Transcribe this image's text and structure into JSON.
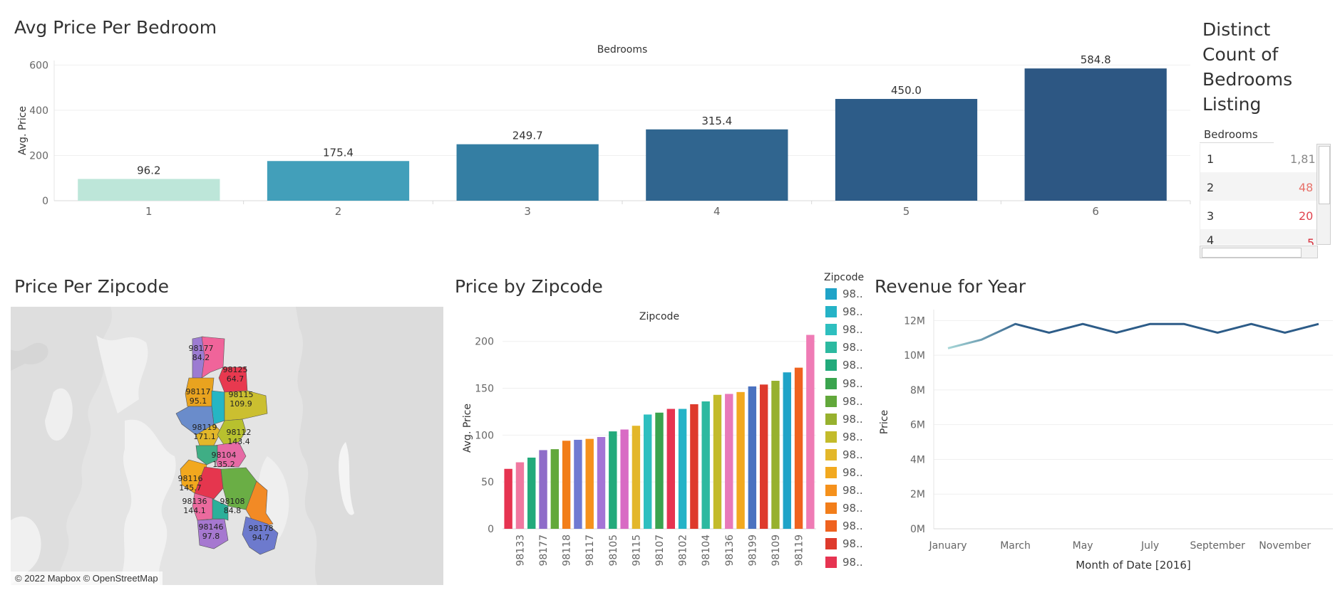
{
  "panels": {
    "avg_price_per_bedroom": {
      "title": "Avg Price Per Bedroom"
    },
    "distinct_count": {
      "title_lines": [
        "Distinct",
        "Count of",
        "Bedrooms",
        "Listing"
      ]
    },
    "price_per_zipcode": {
      "title": "Price Per Zipcode",
      "attribution": "© 2022 Mapbox © OpenStreetMap"
    },
    "price_by_zipcode": {
      "title": "Price by Zipcode"
    },
    "revenue_for_year": {
      "title": "Revenue for Year"
    }
  },
  "count_table": {
    "header": "Bedrooms",
    "rows": [
      {
        "bedrooms": "1",
        "count": "1,81",
        "color": "#888888"
      },
      {
        "bedrooms": "2",
        "count": "48",
        "color": "#e8726a"
      },
      {
        "bedrooms": "3",
        "count": "20",
        "color": "#e0434e"
      },
      {
        "bedrooms": "4",
        "count": "5",
        "color": "#d7303d"
      }
    ]
  },
  "map_labels": [
    {
      "zip": "98177",
      "value": "84.2"
    },
    {
      "zip": "98125",
      "value": "64.7"
    },
    {
      "zip": "98117",
      "value": "95.1"
    },
    {
      "zip": "98115",
      "value": "109.9"
    },
    {
      "zip": "98119",
      "value": "171.1"
    },
    {
      "zip": "98112",
      "value": "143.4"
    },
    {
      "zip": "98104",
      "value": "135.2"
    },
    {
      "zip": "98116",
      "value": "145.7"
    },
    {
      "zip": "98136",
      "value": "144.1"
    },
    {
      "zip": "98108",
      "value": "84.8"
    },
    {
      "zip": "98146",
      "value": "97.8"
    },
    {
      "zip": "98178",
      "value": "94.7"
    }
  ],
  "zip_legend": {
    "title": "Zipcode",
    "items": [
      {
        "label": "98..",
        "color": "#1fa3c8"
      },
      {
        "label": "98..",
        "color": "#25b3c7"
      },
      {
        "label": "98..",
        "color": "#2ebfbf"
      },
      {
        "label": "98..",
        "color": "#2cb9a0"
      },
      {
        "label": "98..",
        "color": "#22aa7b"
      },
      {
        "label": "98..",
        "color": "#3aa44e"
      },
      {
        "label": "98..",
        "color": "#62a83b"
      },
      {
        "label": "98..",
        "color": "#97b12e"
      },
      {
        "label": "98..",
        "color": "#c3bb2b"
      },
      {
        "label": "98..",
        "color": "#e3b72a"
      },
      {
        "label": "98..",
        "color": "#f2a91f"
      },
      {
        "label": "98..",
        "color": "#f5911c"
      },
      {
        "label": "98..",
        "color": "#f27e1a"
      },
      {
        "label": "98..",
        "color": "#ef621f"
      },
      {
        "label": "98..",
        "color": "#de3a2c"
      },
      {
        "label": "98..",
        "color": "#e63451"
      }
    ]
  },
  "chart_data": [
    {
      "id": "avg_price_per_bedroom",
      "type": "bar",
      "title": "Avg Price Per Bedroom",
      "xlabel": "Bedrooms",
      "ylabel": "Avg. Price",
      "categories": [
        "1",
        "2",
        "3",
        "4",
        "5",
        "6"
      ],
      "values": [
        96.2,
        175.4,
        249.7,
        315.4,
        450.0,
        584.8
      ],
      "value_labels": [
        "96.2",
        "175.4",
        "249.7",
        "315.4",
        "450.0",
        "584.8"
      ],
      "colors": [
        "#bde6d9",
        "#429fba",
        "#347ea3",
        "#30658f",
        "#2d5c88",
        "#2d5783"
      ],
      "ylim": [
        0,
        620
      ],
      "yticks": [
        0,
        200,
        400,
        600
      ],
      "grid": true
    },
    {
      "id": "price_by_zipcode",
      "type": "bar",
      "title": "Price by Zipcode",
      "xlabel": "Zipcode",
      "ylabel": "Avg. Price",
      "categories": [
        "",
        "98133",
        "",
        "98177",
        "",
        "98118",
        "",
        "98117",
        "",
        "98105",
        "",
        "98115",
        "",
        "98107",
        "",
        "98102",
        "",
        "98104",
        "",
        "98136",
        "",
        "98199",
        "",
        "98109",
        "",
        "98119",
        ""
      ],
      "values": [
        64,
        71,
        76,
        84,
        85,
        94,
        95,
        96,
        98,
        104,
        106,
        110,
        122,
        124,
        128,
        128,
        133,
        136,
        143,
        144,
        146,
        152,
        154,
        158,
        167,
        172,
        207
      ],
      "colors": [
        "#e63451",
        "#f078a0",
        "#22aa7b",
        "#8e6cc9",
        "#62a83b",
        "#f27e1a",
        "#6f7ad2",
        "#f5911c",
        "#a474d6",
        "#22aa7b",
        "#d86bc4",
        "#e3b72a",
        "#2ebfbf",
        "#3aa44e",
        "#e63451",
        "#25b3c7",
        "#de3a2c",
        "#2cb9a0",
        "#c3bb2b",
        "#e879b9",
        "#f2a91f",
        "#4a72c0",
        "#de3a2c",
        "#97b12e",
        "#1fa3c8",
        "#ef621f",
        "#ef7bb5"
      ],
      "ylim": [
        0,
        215
      ],
      "yticks": [
        0,
        50,
        100,
        150,
        200
      ],
      "grid": true
    },
    {
      "id": "revenue_for_year",
      "type": "line",
      "title": "Revenue for Year",
      "xlabel": "Month of Date [2016]",
      "ylabel": "Price",
      "x": [
        "January",
        "February",
        "March",
        "April",
        "May",
        "June",
        "July",
        "August",
        "September",
        "October",
        "November",
        "December"
      ],
      "xtick_labels": [
        "January",
        "March",
        "May",
        "July",
        "September",
        "November"
      ],
      "y": [
        10.4,
        10.9,
        11.8,
        11.3,
        11.8,
        11.3,
        11.8,
        11.8,
        11.3,
        11.8,
        11.3,
        11.8
      ],
      "yticks": [
        0,
        2,
        4,
        6,
        8,
        10,
        12
      ],
      "ytick_labels": [
        "0M",
        "2M",
        "4M",
        "6M",
        "8M",
        "10M",
        "12M"
      ],
      "ylim": [
        0,
        12.3
      ],
      "line_color_start": "#a8d8d8",
      "line_color_end": "#2d5c88",
      "grid": true
    }
  ]
}
